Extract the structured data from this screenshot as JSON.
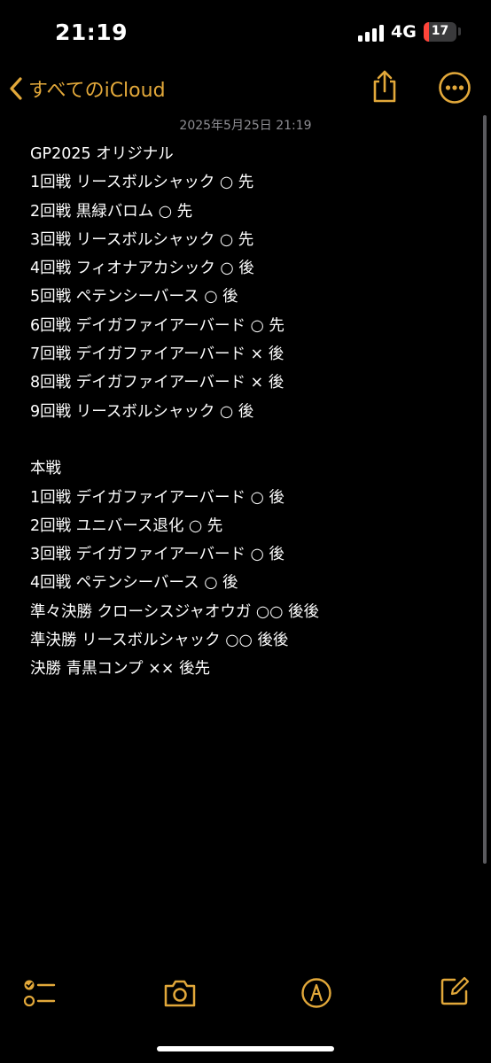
{
  "status_bar": {
    "time": "21:19",
    "network": "4G",
    "battery_level": "17",
    "battery_fraction": 0.17
  },
  "nav": {
    "back_label": "すべてのiCloud",
    "back_icon": "chevron-left-icon",
    "share_icon": "share-icon",
    "more_icon": "ellipsis-circle-icon"
  },
  "note": {
    "date": "2025年5月25日 21:19",
    "lines": [
      "GP2025 オリジナル",
      "1回戦 リースボルシャック ○ 先",
      "2回戦 黒緑バロム ○ 先",
      "3回戦 リースボルシャック ○ 先",
      "4回戦 フィオナアカシック ○ 後",
      "5回戦 ペテンシーバース ○ 後",
      "6回戦 デイガファイアーバード ○ 先",
      "7回戦 デイガファイアーバード × 後",
      "8回戦 デイガファイアーバード × 後",
      "9回戦 リースボルシャック ○ 後",
      "",
      "本戦",
      "1回戦 デイガファイアーバード ○ 後",
      "2回戦 ユニバース退化 ○ 先",
      "3回戦 デイガファイアーバード ○ 後",
      "4回戦 ペテンシーバース ○ 後",
      "準々決勝 クローシスジャオウガ ○○ 後後",
      "準決勝 リースボルシャック ○○ 後後",
      "決勝 青黒コンプ ×× 後先"
    ]
  },
  "toolbar": {
    "checklist_icon": "checklist-icon",
    "camera_icon": "camera-icon",
    "markup_icon": "markup-pen-icon",
    "compose_icon": "compose-icon"
  },
  "colors": {
    "accent": "#e2a83a",
    "background": "#000000",
    "text": "#ffffff",
    "secondary_text": "#8e8e93",
    "battery_low": "#ff453a"
  }
}
